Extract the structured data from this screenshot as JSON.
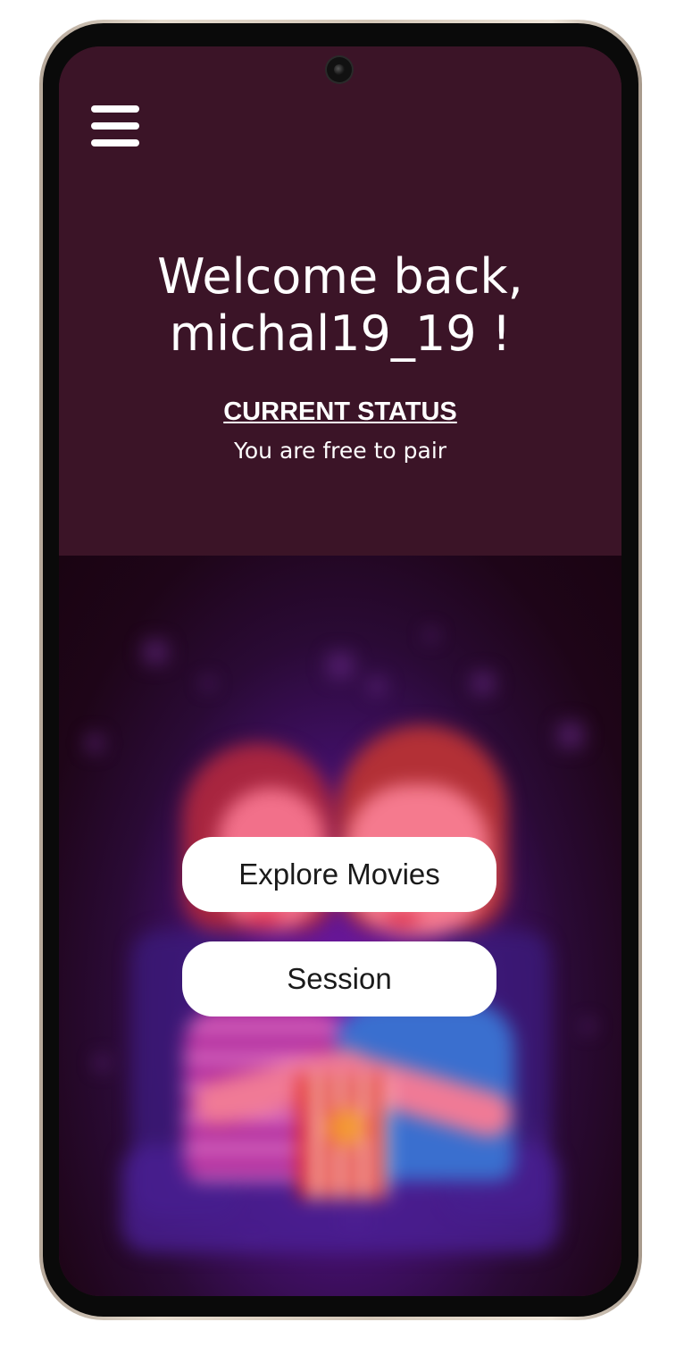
{
  "header": {
    "menu_icon": "hamburger-menu-icon",
    "welcome_line1": "Welcome back,",
    "welcome_line2": "michal19_19 !",
    "status_title": "CURRENT STATUS",
    "status_text": "You are free to pair"
  },
  "actions": {
    "explore_label": "Explore Movies",
    "session_label": "Session"
  },
  "hero": {
    "image": "blurred illustration of couple watching a movie with popcorn"
  },
  "colors": {
    "header_bg": "#3b1427",
    "accent_purple": "#7a1aa8",
    "button_bg": "#ffffff",
    "text_light": "#ffffff"
  }
}
